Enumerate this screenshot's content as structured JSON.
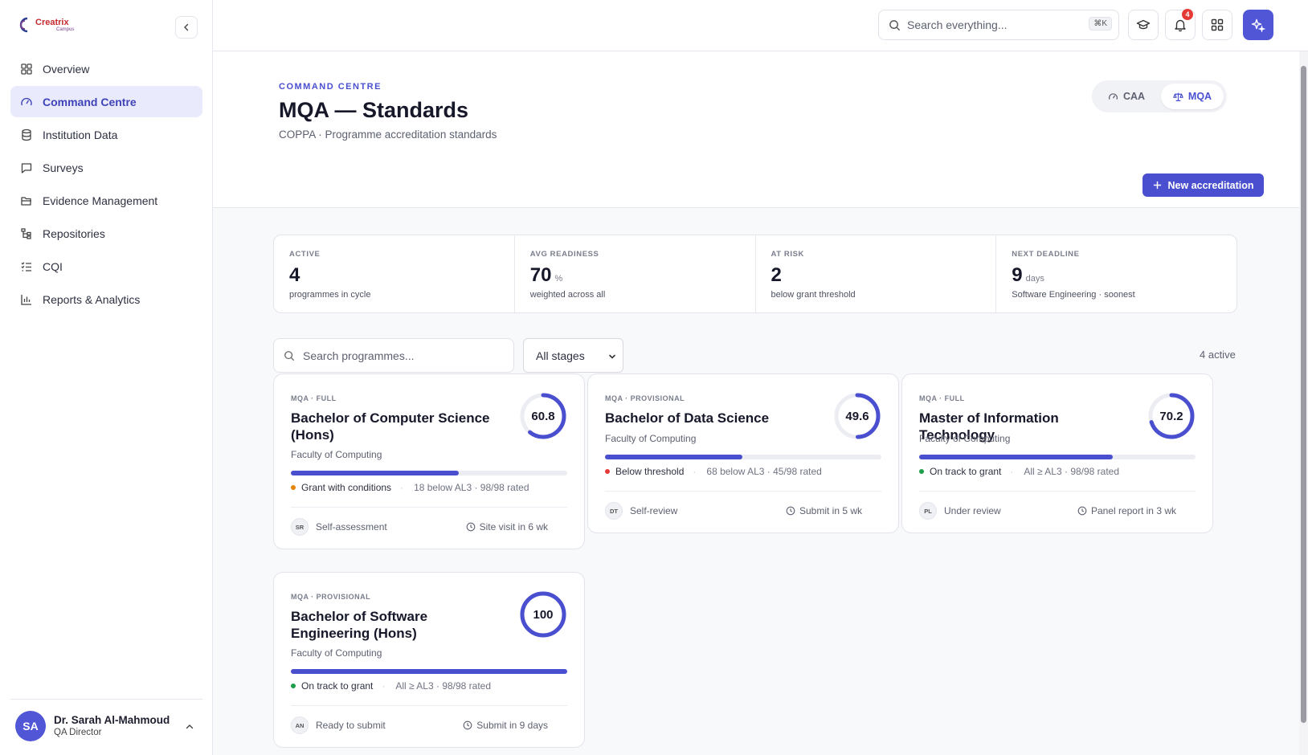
{
  "brand": {
    "name": "Creatrix",
    "sub": "Campus"
  },
  "sidebar": {
    "items": [
      {
        "label": "Overview",
        "icon": "grid-icon"
      },
      {
        "label": "Command Centre",
        "icon": "gauge-icon",
        "active": true
      },
      {
        "label": "Institution Data",
        "icon": "database-icon"
      },
      {
        "label": "Surveys",
        "icon": "message-square-icon"
      },
      {
        "label": "Evidence Management",
        "icon": "folder-open-icon"
      },
      {
        "label": "Repositories",
        "icon": "tree-icon"
      },
      {
        "label": "CQI",
        "icon": "list-checks-icon"
      },
      {
        "label": "Reports & Analytics",
        "icon": "bar-chart-icon"
      }
    ]
  },
  "user": {
    "initials": "SA",
    "name": "Dr. Sarah Al-Mahmoud",
    "role": "QA Director"
  },
  "topbar": {
    "search_placeholder": "Search everything...",
    "shortcut": "⌘K",
    "notification_count": "4"
  },
  "header": {
    "eyebrow": "COMMAND CENTRE",
    "title": "MQA — Standards",
    "subtitle": "COPPA · Programme accreditation standards",
    "toggle": {
      "caa": "CAA",
      "mqa": "MQA",
      "selected": "MQA"
    },
    "new_button": "New accreditation"
  },
  "stats": [
    {
      "label": "ACTIVE",
      "value": "4",
      "unit": "",
      "note": "programmes in cycle"
    },
    {
      "label": "AVG READINESS",
      "value": "70",
      "unit": "%",
      "note": "weighted across all"
    },
    {
      "label": "AT RISK",
      "value": "2",
      "unit": "",
      "note": "below grant threshold"
    },
    {
      "label": "NEXT DEADLINE",
      "value": "9",
      "unit": "days",
      "note": "Software Engineering · soonest"
    }
  ],
  "filters": {
    "search_placeholder": "Search programmes...",
    "stage_selected": "All stages",
    "active_count": "4 active"
  },
  "colors": {
    "accent": "#4a4fcf",
    "warning": "#e5830b",
    "danger": "#e53935",
    "success": "#1e9e4a"
  },
  "programmes": [
    {
      "tag": "MQA · FULL",
      "title": "Bachelor of Computer Science (Hons)",
      "faculty": "Faculty of Computing",
      "score": "60.8",
      "readiness": 0.608,
      "status": "Grant with conditions",
      "status_color": "#e5830b",
      "detail": "18 below AL3 · 98/98 rated",
      "initials": "SR",
      "stage": "Self-assessment",
      "deadline": "Site visit in 6 wk"
    },
    {
      "tag": "MQA · PROVISIONAL",
      "title": "Bachelor of Data Science",
      "faculty": "Faculty of Computing",
      "score": "49.6",
      "readiness": 0.496,
      "status": "Below threshold",
      "status_color": "#e53935",
      "detail": "68 below AL3 · 45/98 rated",
      "initials": "DT",
      "stage": "Self-review",
      "deadline": "Submit in 5 wk"
    },
    {
      "tag": "MQA · FULL",
      "title": "Master of Information Technology",
      "faculty": "Faculty of Computing",
      "score": "70.2",
      "readiness": 0.702,
      "status": "On track to grant",
      "status_color": "#1e9e4a",
      "detail": "All ≥ AL3 · 98/98 rated",
      "initials": "PL",
      "stage": "Under review",
      "deadline": "Panel report in 3 wk"
    },
    {
      "tag": "MQA · PROVISIONAL",
      "title": "Bachelor of Software Engineering (Hons)",
      "faculty": "Faculty of Computing",
      "score": "100",
      "readiness": 1.0,
      "status": "On track to grant",
      "status_color": "#1e9e4a",
      "detail": "All ≥ AL3 · 98/98 rated",
      "initials": "AN",
      "stage": "Ready to submit",
      "deadline": "Submit in 9 days"
    }
  ]
}
